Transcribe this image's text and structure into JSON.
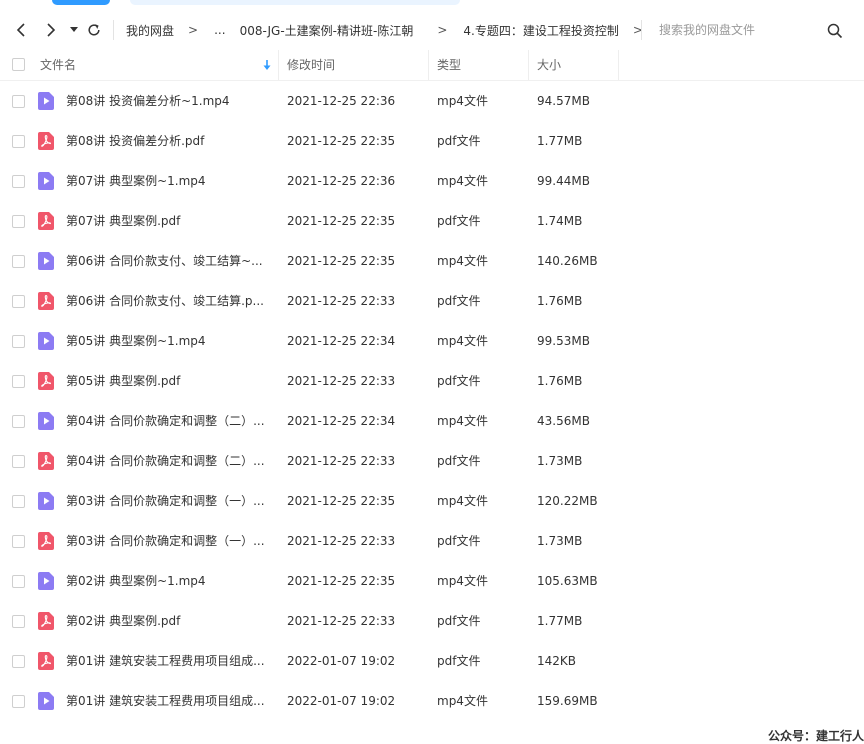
{
  "toolbar": {
    "breadcrumbs": [
      "我的网盘",
      "...",
      "008-JG-土建案例-精讲班-陈江朝",
      "4.专题四：建设工程投资控制"
    ],
    "separator": ">",
    "search_placeholder": "搜索我的网盘文件"
  },
  "table": {
    "headers": {
      "name": "文件名",
      "modified": "修改时间",
      "type": "类型",
      "size": "大小"
    },
    "rows": [
      {
        "icon": "video-file-icon",
        "name": "第08讲   投资偏差分析~1.mp4",
        "time": "2021-12-25 22:36",
        "type": "mp4文件",
        "size": "94.57MB"
      },
      {
        "icon": "pdf-file-icon",
        "name": "第08讲   投资偏差分析.pdf",
        "time": "2021-12-25 22:35",
        "type": "pdf文件",
        "size": "1.77MB"
      },
      {
        "icon": "video-file-icon",
        "name": "第07讲   典型案例~1.mp4",
        "time": "2021-12-25 22:36",
        "type": "mp4文件",
        "size": "99.44MB"
      },
      {
        "icon": "pdf-file-icon",
        "name": "第07讲   典型案例.pdf",
        "time": "2021-12-25 22:35",
        "type": "pdf文件",
        "size": "1.74MB"
      },
      {
        "icon": "video-file-icon",
        "name": "第06讲   合同价款支付、竣工结算~...",
        "time": "2021-12-25 22:35",
        "type": "mp4文件",
        "size": "140.26MB"
      },
      {
        "icon": "pdf-file-icon",
        "name": "第06讲   合同价款支付、竣工结算.p...",
        "time": "2021-12-25 22:33",
        "type": "pdf文件",
        "size": "1.76MB"
      },
      {
        "icon": "video-file-icon",
        "name": "第05讲   典型案例~1.mp4",
        "time": "2021-12-25 22:34",
        "type": "mp4文件",
        "size": "99.53MB"
      },
      {
        "icon": "pdf-file-icon",
        "name": "第05讲   典型案例.pdf",
        "time": "2021-12-25 22:33",
        "type": "pdf文件",
        "size": "1.76MB"
      },
      {
        "icon": "video-file-icon",
        "name": "第04讲   合同价款确定和调整（二）...",
        "time": "2021-12-25 22:34",
        "type": "mp4文件",
        "size": "43.56MB"
      },
      {
        "icon": "pdf-file-icon",
        "name": "第04讲   合同价款确定和调整（二）...",
        "time": "2021-12-25 22:33",
        "type": "pdf文件",
        "size": "1.73MB"
      },
      {
        "icon": "video-file-icon",
        "name": "第03讲   合同价款确定和调整（一）...",
        "time": "2021-12-25 22:35",
        "type": "mp4文件",
        "size": "120.22MB"
      },
      {
        "icon": "pdf-file-icon",
        "name": "第03讲   合同价款确定和调整（一）...",
        "time": "2021-12-25 22:33",
        "type": "pdf文件",
        "size": "1.73MB"
      },
      {
        "icon": "video-file-icon",
        "name": "第02讲   典型案例~1.mp4",
        "time": "2021-12-25 22:35",
        "type": "mp4文件",
        "size": "105.63MB"
      },
      {
        "icon": "pdf-file-icon",
        "name": "第02讲   典型案例.pdf",
        "time": "2021-12-25 22:33",
        "type": "pdf文件",
        "size": "1.77MB"
      },
      {
        "icon": "pdf-file-icon",
        "name": "第01讲   建筑安装工程费用项目组成...",
        "time": "2022-01-07 19:02",
        "type": "pdf文件",
        "size": "142KB"
      },
      {
        "icon": "video-file-icon",
        "name": "第01讲   建筑安装工程费用项目组成...",
        "time": "2022-01-07 19:02",
        "type": "mp4文件",
        "size": "159.69MB"
      }
    ]
  },
  "watermark": "公众号：建工行人",
  "colors": {
    "accent": "#2f9bff",
    "video_icon": "#8c7bf3",
    "pdf_icon": "#f0566a",
    "sort_arrow": "#2f9bff"
  }
}
